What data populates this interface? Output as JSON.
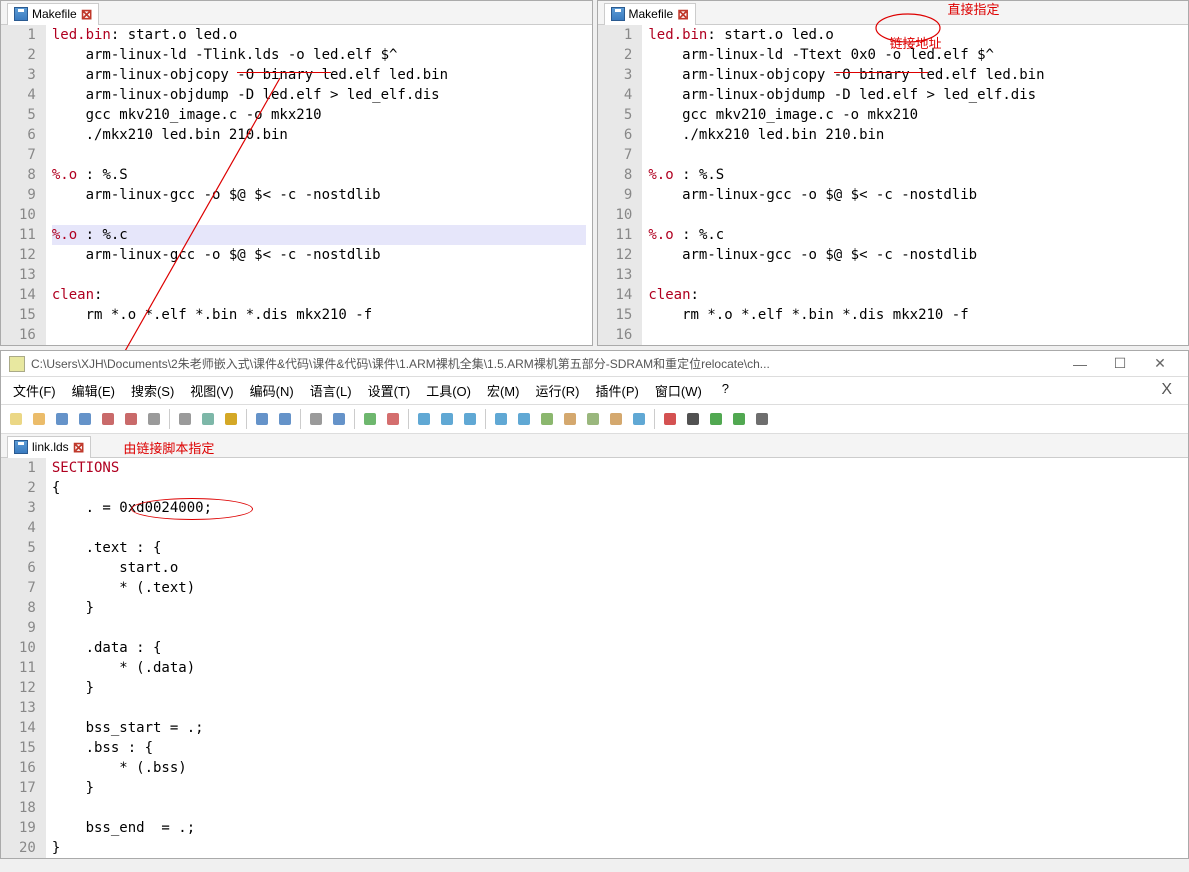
{
  "top_left": {
    "tab": "Makefile",
    "annotation_right": "",
    "lines": [
      {
        "n": 1,
        "pre": "",
        "tgt": "led.bin",
        "post": ": start.o led.o"
      },
      {
        "n": 2,
        "text": "    arm-linux-ld -Tlink.lds -o led.elf $^"
      },
      {
        "n": 3,
        "text": "    arm-linux-objcopy -O binary led.elf led.bin"
      },
      {
        "n": 4,
        "text": "    arm-linux-objdump -D led.elf > led_elf.dis"
      },
      {
        "n": 5,
        "text": "    gcc mkv210_image.c -o mkx210"
      },
      {
        "n": 6,
        "text": "    ./mkx210 led.bin 210.bin"
      },
      {
        "n": 7,
        "text": ""
      },
      {
        "n": 8,
        "pre": "",
        "tgt": "%.o",
        "post": " : %.S"
      },
      {
        "n": 9,
        "text": "    arm-linux-gcc -o $@ $< -c -nostdlib"
      },
      {
        "n": 10,
        "text": ""
      },
      {
        "n": 11,
        "pre": "",
        "tgt": "%.o",
        "post": " : %.c",
        "hl": true
      },
      {
        "n": 12,
        "text": "    arm-linux-gcc -o $@ $< -c -nostdlib"
      },
      {
        "n": 13,
        "text": ""
      },
      {
        "n": 14,
        "pre": "",
        "tgt": "clean",
        "post": ":"
      },
      {
        "n": 15,
        "text": "    rm *.o *.elf *.bin *.dis mkx210 -f"
      },
      {
        "n": 16,
        "text": ""
      }
    ]
  },
  "top_right": {
    "tab": "Makefile",
    "annotation_a": "直接指定",
    "annotation_b": "链接地址",
    "lines": [
      {
        "n": 1,
        "pre": "",
        "tgt": "led.bin",
        "post": ": start.o led.o"
      },
      {
        "n": 2,
        "text": "    arm-linux-ld -Ttext 0x0 -o led.elf $^"
      },
      {
        "n": 3,
        "text": "    arm-linux-objcopy -O binary led.elf led.bin"
      },
      {
        "n": 4,
        "text": "    arm-linux-objdump -D led.elf > led_elf.dis"
      },
      {
        "n": 5,
        "text": "    gcc mkv210_image.c -o mkx210"
      },
      {
        "n": 6,
        "text": "    ./mkx210 led.bin 210.bin"
      },
      {
        "n": 7,
        "text": ""
      },
      {
        "n": 8,
        "pre": "",
        "tgt": "%.o",
        "post": " : %.S"
      },
      {
        "n": 9,
        "text": "    arm-linux-gcc -o $@ $< -c -nostdlib"
      },
      {
        "n": 10,
        "text": ""
      },
      {
        "n": 11,
        "pre": "",
        "tgt": "%.o",
        "post": " : %.c"
      },
      {
        "n": 12,
        "text": "    arm-linux-gcc -o $@ $< -c -nostdlib"
      },
      {
        "n": 13,
        "text": ""
      },
      {
        "n": 14,
        "pre": "",
        "tgt": "clean",
        "post": ":"
      },
      {
        "n": 15,
        "text": "    rm *.o *.elf *.bin *.dis mkx210 -f"
      },
      {
        "n": 16,
        "text": ""
      }
    ]
  },
  "bottom": {
    "title": "C:\\Users\\XJH\\Documents\\2朱老师嵌入式\\课件&代码\\课件&代码\\课件\\1.ARM裸机全集\\1.5.ARM裸机第五部分-SDRAM和重定位relocate\\ch...",
    "menus": [
      "文件(F)",
      "编辑(E)",
      "搜索(S)",
      "视图(V)",
      "编码(N)",
      "语言(L)",
      "设置(T)",
      "工具(O)",
      "宏(M)",
      "运行(R)",
      "插件(P)",
      "窗口(W)"
    ],
    "menu_q": "?",
    "menu_x": "X",
    "tab": "link.lds",
    "annotation": "由链接脚本指定",
    "lines": [
      {
        "n": 1,
        "kw": "SECTIONS",
        "post": ""
      },
      {
        "n": 2,
        "text": "{"
      },
      {
        "n": 3,
        "text": "    . = 0xd0024000;"
      },
      {
        "n": 4,
        "text": ""
      },
      {
        "n": 5,
        "text": "    .text : {"
      },
      {
        "n": 6,
        "text": "        start.o"
      },
      {
        "n": 7,
        "text": "        * (.text)"
      },
      {
        "n": 8,
        "text": "    }"
      },
      {
        "n": 9,
        "text": ""
      },
      {
        "n": 10,
        "text": "    .data : {"
      },
      {
        "n": 11,
        "text": "        * (.data)"
      },
      {
        "n": 12,
        "text": "    }"
      },
      {
        "n": 13,
        "text": ""
      },
      {
        "n": 14,
        "text": "    bss_start = .;"
      },
      {
        "n": 15,
        "text": "    .bss : {"
      },
      {
        "n": 16,
        "text": "        * (.bss)"
      },
      {
        "n": 17,
        "text": "    }"
      },
      {
        "n": 18,
        "text": ""
      },
      {
        "n": 19,
        "text": "    bss_end  = .;"
      },
      {
        "n": 20,
        "text": "}"
      }
    ],
    "toolbar_icons": [
      "new-file-icon",
      "open-file-icon",
      "save-icon",
      "save-all-icon",
      "close-icon",
      "close-all-icon",
      "print-icon",
      "sep",
      "cut-icon",
      "copy-icon",
      "paste-icon",
      "sep",
      "undo-icon",
      "redo-icon",
      "sep",
      "find-icon",
      "replace-icon",
      "sep",
      "zoom-in-icon",
      "zoom-out-icon",
      "sep",
      "sync-v-icon",
      "sync-h-icon",
      "wrap-icon",
      "sep",
      "show-all-icon",
      "indent-guide-icon",
      "lang-icon",
      "doc-map-icon",
      "func-list-icon",
      "folder-icon",
      "monitor-icon",
      "sep",
      "record-macro-icon",
      "stop-macro-icon",
      "play-macro-icon",
      "play-multi-icon",
      "save-macro-icon"
    ]
  }
}
